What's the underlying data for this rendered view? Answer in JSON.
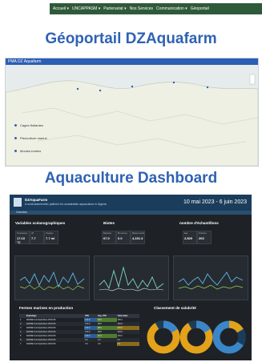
{
  "nav": {
    "items": [
      "Accueil ▾",
      "UNCAPPASM ▾",
      "Partenariat ▾",
      "Nos Services",
      "Communication ▾",
      "Géoportail"
    ]
  },
  "titles": {
    "geoportail": "Géoportail DZAquafarm",
    "dashboard": "Aquaculture Dashboard"
  },
  "map": {
    "header": "PMA DZ Aquafarm",
    "legend": [
      "Cages flottantes",
      "Pisciculture marine",
      "Moules-huitres"
    ]
  },
  "dashboard": {
    "title": "DZAquaFarm",
    "subtitle": "A multi-stakeholder platform for sustainable aquaculture in Algeria",
    "date_range": "10 mai 2023 - 6 juin 2023",
    "tab": "Overview",
    "sections": {
      "ocean": "Variables océanographiques",
      "biotes": "Biotes",
      "samples": "nombre d'échantillons",
      "farms": "Fermes marines en production",
      "salubrity": "Classement de salubrité"
    },
    "ocean_cards": [
      {
        "label": "Température",
        "value": "17.10 °C"
      },
      {
        "label": "pH",
        "value": "7.7"
      },
      {
        "label": "Oxygène",
        "value": "7.7 ml"
      }
    ],
    "biotes_cards": [
      {
        "label": "Bactéries",
        "value": "67.0"
      },
      {
        "label": "Bio-toxines",
        "value": "0.0"
      },
      {
        "label": "Métaux lourds",
        "value": "4,151.3"
      }
    ],
    "sample_cards": [
      {
        "label": "Eau",
        "value": "2,529"
      },
      {
        "label": "Poissons",
        "value": "203"
      }
    ],
    "table": {
      "headers": [
        "Exploitage",
        "STE",
        "Avg. STS",
        "Total value"
      ],
      "rows": [
        [
          "1.",
          "FERME Conchyliculture 2019-08",
          "100.0",
          "99.9",
          "195.4"
        ],
        [
          "2.",
          "FERME Conchyliculture 2019-08",
          "100.0",
          "98.6",
          "135.3"
        ],
        [
          "3.",
          "FERME Conchyliculture 2019-08",
          "100.0",
          "98.8",
          "200.8"
        ],
        [
          "4.",
          "FERME Conchyliculture 2019-08",
          "100.0",
          "98.8",
          "163.6"
        ],
        [
          "5.",
          "FERME Conchyliculture 2019-08",
          "100.0",
          "97.9",
          "135.2"
        ],
        [
          "6.",
          "FERME Conchyliculture 2019-08",
          "0.0",
          "0.0",
          "0.0"
        ],
        [
          "7.",
          "FERME Conchyliculture 2019-08",
          "0.0",
          "0.0",
          "0.0"
        ]
      ]
    },
    "colors": {
      "blue": "#3a86c8",
      "yellow": "#e3a21a",
      "navy": "#1b3d5c"
    }
  }
}
